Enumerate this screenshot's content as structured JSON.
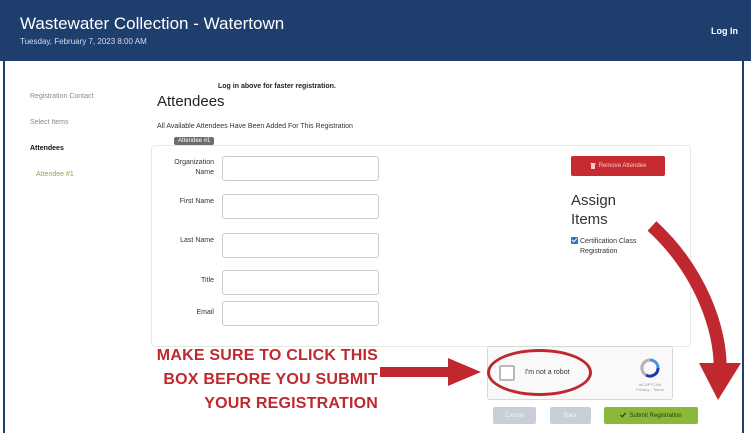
{
  "header": {
    "title": "Wastewater Collection - Watertown",
    "subtitle": "Tuesday, February 7, 2023 8:00 AM",
    "login": "Log In"
  },
  "sidebar": {
    "items": [
      {
        "label": "Registration Contact",
        "state": "inactive"
      },
      {
        "label": "Select Items",
        "state": "inactive"
      },
      {
        "label": "Attendees",
        "state": "active"
      },
      {
        "label": "Attendee #1",
        "state": "sub"
      }
    ]
  },
  "main": {
    "login_note": "Log in above for faster registration.",
    "title": "Attendees",
    "info": "All Available Attendees Have Been Added For This Registration",
    "attendee_tag": "Attendee #1",
    "fields": [
      {
        "label": "Organization Name",
        "value": ""
      },
      {
        "label": "First Name",
        "value": ""
      },
      {
        "label": "Last Name",
        "value": ""
      },
      {
        "label": "Title",
        "value": ""
      },
      {
        "label": "Email",
        "value": ""
      }
    ],
    "remove_button": "Remove Attendee",
    "assign_heading": "Assign Items",
    "certification": "Certification Class Registration"
  },
  "recaptcha": {
    "label": "I'm not a robot",
    "brand": "reCAPTCHA",
    "links": "Privacy - Terms"
  },
  "callout": {
    "lines": [
      "MAKE SURE TO CLICK THIS",
      "BOX BEFORE YOU SUBMIT",
      "YOUR REGISTRATION"
    ]
  },
  "buttons": {
    "cancel": "Cancel",
    "back": "Back",
    "submit": "Submit Registration"
  },
  "colors": {
    "header": "#1e3e6e",
    "annotation": "#c0282f",
    "submit": "#8cb83a",
    "remove": "#c62b30"
  }
}
